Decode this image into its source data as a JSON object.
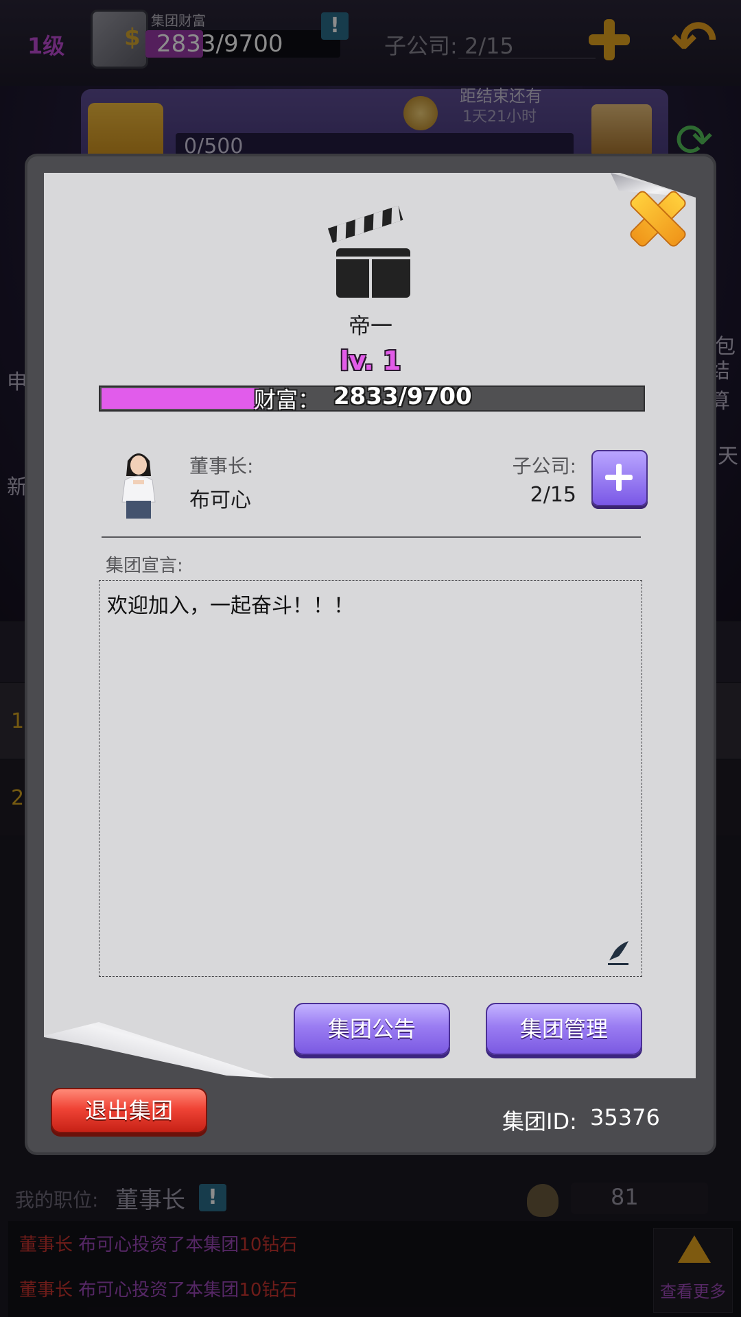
{
  "top_bar": {
    "level": "1级",
    "wealth_caption": "集团财富",
    "wealth_text": "2833/9700",
    "subsidiaries": "子公司: 2/15",
    "info_badge": "!"
  },
  "event": {
    "progress": "0/500",
    "remain_title": "距结束还有",
    "remain_time": "1天21小时"
  },
  "side_labels": {
    "left_1": "申",
    "left_2": "新",
    "right_1": "包",
    "right_2": "结算",
    "right_3": "天"
  },
  "rank_rows": [
    "1",
    "2"
  ],
  "modal": {
    "group_name": "帝一",
    "group_level": "lv. 1",
    "wealth_label": "财富：",
    "wealth_value": "2833/9700",
    "wealth_progress": 0.29,
    "chairman_label": "董事长:",
    "chairman_name": "布可心",
    "subsidiary_label": "子公司:",
    "subsidiary_value": "2/15",
    "declaration_label": "集团宣言:",
    "declaration_text": "欢迎加入，一起奋斗！！！",
    "announce_button": "集团公告",
    "manage_button": "集团管理",
    "quit_button": "退出集团",
    "group_id_label": "集团ID:",
    "group_id_value": "35376"
  },
  "footer": {
    "position_label": "我的职位:",
    "position_value": "董事长",
    "diamond_count": "81",
    "logs": [
      {
        "role": "董事长",
        "name": "布可心",
        "action": "投资了本集团",
        "amount": "10钻石"
      },
      {
        "role": "董事长",
        "name": "布可心",
        "action": "投资了本集团",
        "amount": "10钻石"
      }
    ],
    "more_label": "查看更多"
  },
  "colors": {
    "accent_purple": "#8f6cf0",
    "wealth_pink": "#e15ceb",
    "quit_red": "#e8372a",
    "gold": "#e6a620"
  }
}
